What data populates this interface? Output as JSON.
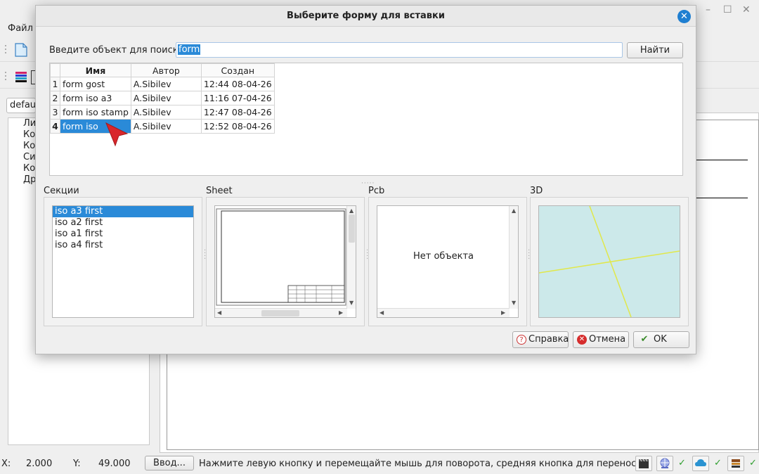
{
  "app": {
    "menu": {
      "file_label": "Файл"
    },
    "combo_value": "default",
    "tree_items": [
      "Ли",
      "Ко",
      "Ко",
      "Си",
      "Ко",
      "Др"
    ],
    "window_controls": {
      "minimize": "–",
      "maximize": "☐",
      "close": "✕"
    }
  },
  "dialog": {
    "title": "Выберите форму для вставки",
    "close_glyph": "✕",
    "search": {
      "label": "Введите объект для поиска:",
      "value": "form",
      "button_label": "Найти"
    },
    "table": {
      "columns": [
        "Имя",
        "Автор",
        "Создан"
      ],
      "rows": [
        {
          "num": "1",
          "name": "form gost",
          "author": "A.Sibilev",
          "created": "12:44 08-04-26"
        },
        {
          "num": "2",
          "name": "form iso a3",
          "author": "A.Sibilev",
          "created": "11:16 07-04-26"
        },
        {
          "num": "3",
          "name": "form iso stamp",
          "author": "A.Sibilev",
          "created": "12:47 08-04-26"
        },
        {
          "num": "4",
          "name": "form iso",
          "author": "A.Sibilev",
          "created": "12:52 08-04-26"
        }
      ],
      "selected_row": 4
    },
    "panels": {
      "sections_title": "Секции",
      "sheet_title": "Sheet",
      "pcb_title": "Pcb",
      "three_d_title": "3D",
      "sections": [
        "iso a3 first",
        "iso a2 first",
        "iso a1 first",
        "iso a4 first"
      ],
      "selected_section": "iso a3 first",
      "pcb_empty_text": "Нет объекта"
    },
    "buttons": {
      "help": "Справка",
      "cancel": "Отмена",
      "ok": "OK"
    }
  },
  "statusbar": {
    "x_label": "X:",
    "x_value": "2.000",
    "y_label": "Y:",
    "y_value": "49.000",
    "input_button": "Ввод...",
    "hint": "Нажмите левую кнопку и перемещайте мышь для поворота, средняя кнопка для переноса",
    "check_glyph": "✓"
  },
  "colors": {
    "selection": "#2a8ad8",
    "three_d_background": "#cce9ea",
    "three_d_lines": "#e1e84a",
    "cursor_arrow": "#d9262b"
  }
}
